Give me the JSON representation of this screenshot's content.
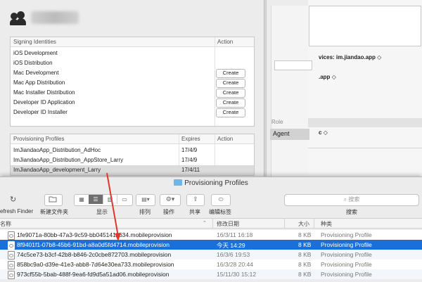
{
  "right_window": {
    "devices_label": "vices: im.jiandao.app",
    "devices_chevron": "◇",
    "app_label": ".app",
    "app_chevron": "◇",
    "c_label": "c",
    "c_chevron": "◇"
  },
  "role": {
    "header": "Role",
    "value": "Agent"
  },
  "signing": {
    "header_name": "Signing Identities",
    "header_action": "Action",
    "rows": [
      {
        "name": "iOS Development",
        "action": ""
      },
      {
        "name": "iOS Distribution",
        "action": ""
      },
      {
        "name": "Mac Development",
        "action": "Create"
      },
      {
        "name": "Mac App Distribution",
        "action": "Create"
      },
      {
        "name": "Mac Installer Distribution",
        "action": "Create"
      },
      {
        "name": "Developer ID Application",
        "action": "Create"
      },
      {
        "name": "Developer ID Installer",
        "action": "Create"
      }
    ]
  },
  "profiles": {
    "header_name": "Provisioning Profiles",
    "header_expires": "Expires",
    "header_action": "Action",
    "rows": [
      {
        "name": "ImJiandaoApp_Distribution_AdHoc",
        "expires": "17/4/9"
      },
      {
        "name": "ImJiandaoApp_Distribution_AppStore_Larry",
        "expires": "17/4/9"
      },
      {
        "name": "ImJiandaoApp_development_Larry",
        "expires": "17/4/11"
      }
    ]
  },
  "finder": {
    "title": "Provisioning Profiles",
    "toolbar": {
      "refresh": "efresh Finder",
      "new_folder": "新建文件夹",
      "view": "显示",
      "arrange": "排列",
      "action": "操作",
      "share": "共享",
      "edit_tags": "编辑标签",
      "search_placeholder": "搜索",
      "search_label": "搜索"
    },
    "columns": {
      "name": "名称",
      "modified": "修改日期",
      "size": "大小",
      "kind": "种类"
    },
    "files": [
      {
        "name": "1fe9071a-80bb-47a3-9c59-bb0451411634.mobileprovision",
        "modified": "16/3/11 16:18",
        "size": "8 KB",
        "kind": "Provisioning Profile"
      },
      {
        "name": "8f9401f1-07b8-45b6-91bd-a8a0d5fd4714.mobileprovision",
        "modified": "今天 14:29",
        "size": "8 KB",
        "kind": "Provisioning Profile"
      },
      {
        "name": "74c5ce73-b3cf-42b8-b846-2c0cbe872703.mobileprovision",
        "modified": "16/3/6 19:53",
        "size": "8 KB",
        "kind": "Provisioning Profile"
      },
      {
        "name": "858bc9a0-d39e-41e3-abb8-7d64e30ea733.mobileprovision",
        "modified": "16/3/28 20:44",
        "size": "8 KB",
        "kind": "Provisioning Profile"
      },
      {
        "name": "973cf55b-5bab-488f-9ea6-fd9d5a51ad06.mobileprovision",
        "modified": "15/11/30 15:12",
        "size": "8 KB",
        "kind": "Provisioning Profile"
      }
    ],
    "selected_index": 1
  },
  "annotation": {
    "arrow_color": "#e0362b"
  },
  "colors": {
    "selection": "#1a6fd8",
    "folder": "#6fb6e8"
  }
}
